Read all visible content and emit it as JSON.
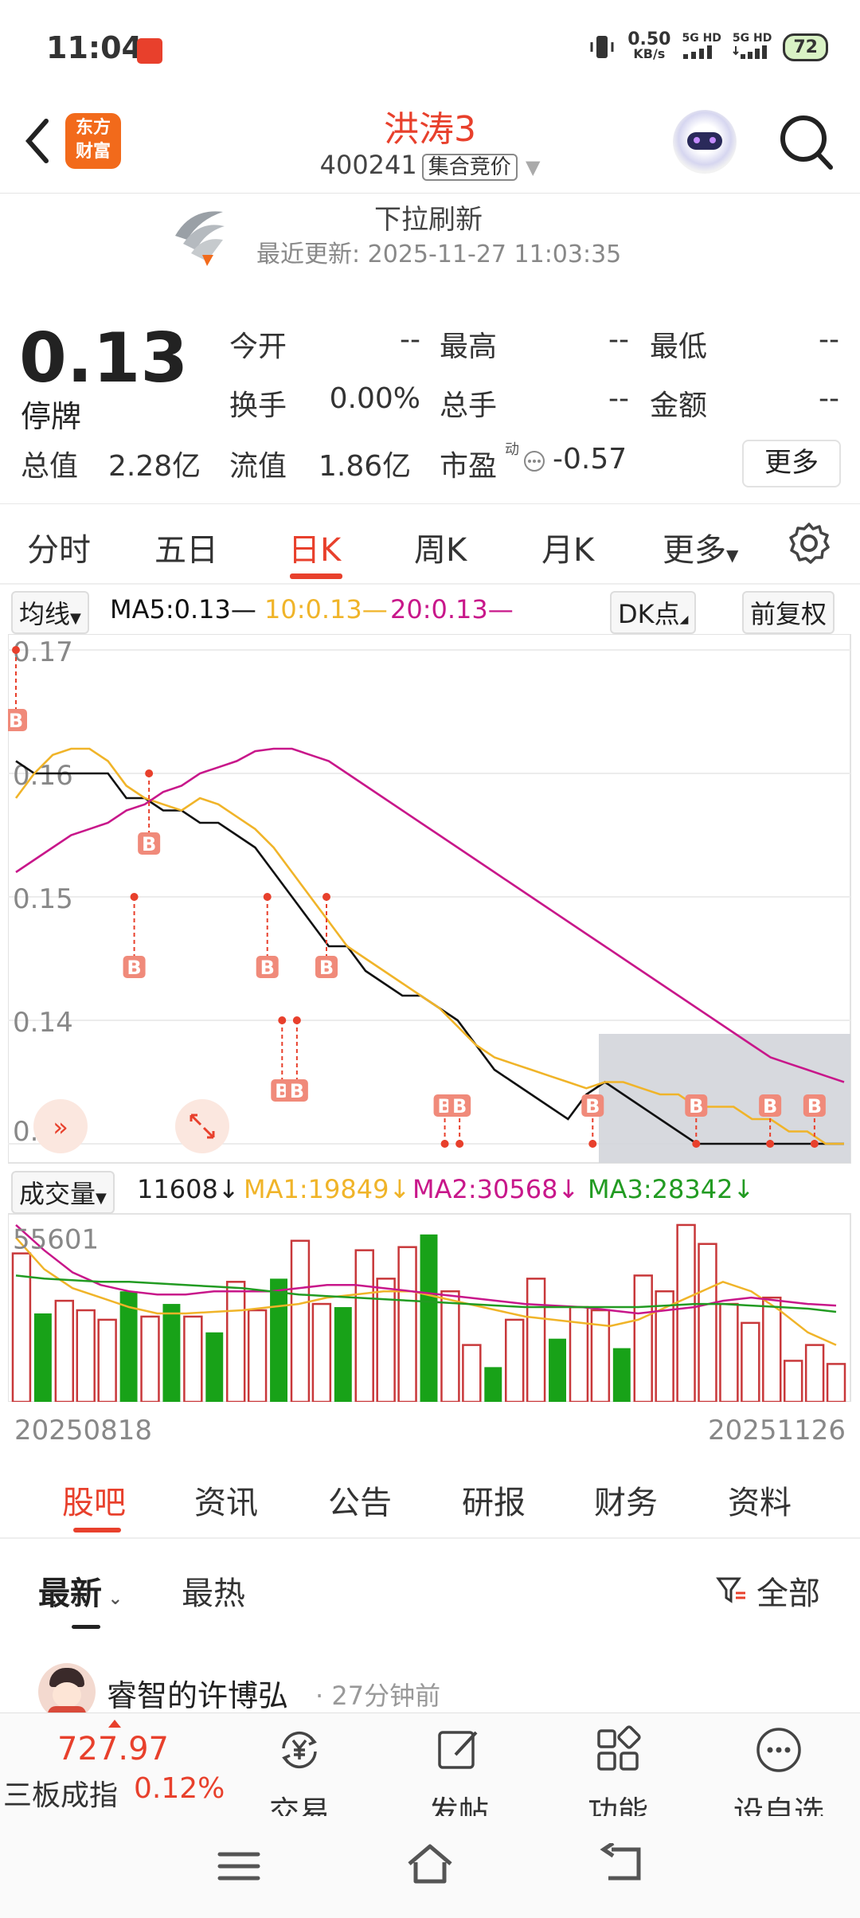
{
  "status_bar": {
    "time": "11:04",
    "speed": "0.50",
    "speed_unit": "KB/s",
    "net1": "5G HD",
    "net2": "5G HD",
    "battery": "72"
  },
  "header": {
    "logo_line1": "东方",
    "logo_line2": "财富",
    "stock_name": "洪涛3",
    "stock_code": "400241",
    "code_tag": "集合竞价"
  },
  "refresh": {
    "title": "下拉刷新",
    "updated": "最近更新: 2025-11-27 11:03:35"
  },
  "quote": {
    "price": "0.13",
    "status": "停牌",
    "rows": [
      [
        {
          "label": "今开",
          "value": "--"
        },
        {
          "label": "最高",
          "value": "--"
        },
        {
          "label": "最低",
          "value": "--"
        }
      ],
      [
        {
          "label": "换手",
          "value": "0.00%"
        },
        {
          "label": "总手",
          "value": "--"
        },
        {
          "label": "金额",
          "value": "--"
        }
      ]
    ],
    "total_mv_label": "总值",
    "total_mv": "2.28亿",
    "float_mv_label": "流值",
    "float_mv": "1.86亿",
    "pe_label": "市盈",
    "pe_sup": "动",
    "pe": "-0.57",
    "more": "更多"
  },
  "tabs": [
    "分时",
    "五日",
    "日K",
    "周K",
    "月K",
    "更多"
  ],
  "ma_bar": {
    "mode": "均线",
    "ma5": "MA5:0.13—",
    "ma10": "10:0.13—",
    "ma20": "20:0.13—",
    "dk": "DK点",
    "adjust": "前复权"
  },
  "vol_bar": {
    "mode": "成交量",
    "vol": "11608↓",
    "ma1": "MA1:19849↓",
    "ma2": "MA2:30568↓",
    "ma3": "MA3:28342↓"
  },
  "colors": {
    "up": "#c8383a",
    "down": "#18a218",
    "ma5": "#111111",
    "ma10": "#f0b429",
    "ma20": "#c8178a",
    "vol_ma3": "#229b22",
    "accent": "#e8402c"
  },
  "chart_data": [
    {
      "type": "line",
      "y_ticks": [
        "0.17",
        "0.16",
        "0.15",
        "0.14",
        "0.13"
      ],
      "ylim": [
        0.13,
        0.17
      ],
      "series": [
        {
          "name": "MA5",
          "values": [
            0.161,
            0.16,
            0.16,
            0.16,
            0.16,
            0.16,
            0.158,
            0.158,
            0.157,
            0.157,
            0.156,
            0.156,
            0.155,
            0.154,
            0.152,
            0.15,
            0.148,
            0.146,
            0.146,
            0.144,
            0.143,
            0.142,
            0.142,
            0.141,
            0.14,
            0.138,
            0.136,
            0.135,
            0.134,
            0.133,
            0.132,
            0.134,
            0.135,
            0.134,
            0.133,
            0.132,
            0.131,
            0.13,
            0.13,
            0.13,
            0.13,
            0.13,
            0.13,
            0.13,
            0.13,
            0.13
          ]
        },
        {
          "name": "MA10",
          "values": [
            0.158,
            0.16,
            0.1615,
            0.162,
            0.162,
            0.161,
            0.159,
            0.158,
            0.1575,
            0.157,
            0.158,
            0.1575,
            0.1565,
            0.1555,
            0.154,
            0.152,
            0.15,
            0.148,
            0.146,
            0.145,
            0.144,
            0.143,
            0.142,
            0.141,
            0.1395,
            0.138,
            0.137,
            0.1365,
            0.136,
            0.1355,
            0.135,
            0.1345,
            0.135,
            0.135,
            0.1345,
            0.134,
            0.134,
            0.133,
            0.133,
            0.133,
            0.132,
            0.132,
            0.131,
            0.131,
            0.13,
            0.13
          ]
        },
        {
          "name": "MA20",
          "values": [
            0.152,
            0.153,
            0.154,
            0.155,
            0.1555,
            0.156,
            0.157,
            0.1575,
            0.1585,
            0.159,
            0.16,
            0.1605,
            0.161,
            0.1618,
            0.162,
            0.162,
            0.1615,
            0.161,
            0.16,
            0.159,
            0.158,
            0.157,
            0.156,
            0.155,
            0.154,
            0.153,
            0.152,
            0.151,
            0.15,
            0.149,
            0.148,
            0.147,
            0.146,
            0.145,
            0.144,
            0.143,
            0.142,
            0.141,
            0.14,
            0.139,
            0.138,
            0.137,
            0.1365,
            0.136,
            0.1355,
            0.135
          ]
        }
      ],
      "markers": [
        {
          "label": "B",
          "index": 0,
          "price": 0.17
        },
        {
          "label": "B",
          "index": 9,
          "price": 0.16
        },
        {
          "label": "B",
          "index": 8,
          "price": 0.15
        },
        {
          "label": "B",
          "index": 17,
          "price": 0.15
        },
        {
          "label": "B",
          "index": 21,
          "price": 0.15
        },
        {
          "label": "B",
          "index": 18,
          "price": 0.14
        },
        {
          "label": "B",
          "index": 19,
          "price": 0.14
        },
        {
          "label": "B",
          "index": 29,
          "price": 0.13
        },
        {
          "label": "B",
          "index": 30,
          "price": 0.13
        },
        {
          "label": "B",
          "index": 39,
          "price": 0.13
        },
        {
          "label": "B",
          "index": 46,
          "price": 0.13
        },
        {
          "label": "B",
          "index": 51,
          "price": 0.13
        },
        {
          "label": "B",
          "index": 54,
          "price": 0.13
        }
      ]
    },
    {
      "type": "bar",
      "y_ticks": [
        "55601"
      ],
      "first_date": "20250818",
      "last_date": "20251126",
      "volumes": [
        {
          "v": 47000,
          "up": true
        },
        {
          "v": 28000,
          "up": false
        },
        {
          "v": 32000,
          "up": true
        },
        {
          "v": 29000,
          "up": true
        },
        {
          "v": 26000,
          "up": true
        },
        {
          "v": 35000,
          "up": false
        },
        {
          "v": 27000,
          "up": true
        },
        {
          "v": 31000,
          "up": false
        },
        {
          "v": 27000,
          "up": true
        },
        {
          "v": 22000,
          "up": false
        },
        {
          "v": 38000,
          "up": true
        },
        {
          "v": 29000,
          "up": true
        },
        {
          "v": 39000,
          "up": false
        },
        {
          "v": 51000,
          "up": true
        },
        {
          "v": 31000,
          "up": true
        },
        {
          "v": 30000,
          "up": false
        },
        {
          "v": 48000,
          "up": true
        },
        {
          "v": 39000,
          "up": true
        },
        {
          "v": 49000,
          "up": true
        },
        {
          "v": 53000,
          "up": false
        },
        {
          "v": 35000,
          "up": true
        },
        {
          "v": 18000,
          "up": true
        },
        {
          "v": 11000,
          "up": false
        },
        {
          "v": 26000,
          "up": true
        },
        {
          "v": 39000,
          "up": true
        },
        {
          "v": 20000,
          "up": false
        },
        {
          "v": 30000,
          "up": true
        },
        {
          "v": 29000,
          "up": true
        },
        {
          "v": 17000,
          "up": false
        },
        {
          "v": 40000,
          "up": true
        },
        {
          "v": 35000,
          "up": true
        },
        {
          "v": 56000,
          "up": true
        },
        {
          "v": 50000,
          "up": true
        },
        {
          "v": 31000,
          "up": true
        },
        {
          "v": 25000,
          "up": true
        },
        {
          "v": 33000,
          "up": true
        },
        {
          "v": 13000,
          "up": true
        },
        {
          "v": 18000,
          "up": true
        },
        {
          "v": 12000,
          "up": true
        }
      ],
      "series": [
        {
          "name": "MA1",
          "values": [
            52000,
            42000,
            36000,
            33000,
            30000,
            28000,
            28000,
            28500,
            29000,
            30000,
            31000,
            33000,
            34000,
            35000,
            35000,
            33000,
            31000,
            29000,
            27000,
            26000,
            25000,
            24000,
            26000,
            30000,
            34000,
            38000,
            35000,
            29000,
            22000,
            18000
          ]
        },
        {
          "name": "MA2",
          "values": [
            56000,
            48000,
            41000,
            37000,
            35000,
            34000,
            34000,
            35000,
            35000,
            35000,
            36000,
            37000,
            37000,
            36000,
            35000,
            34000,
            33000,
            32000,
            31000,
            30500,
            30000,
            29000,
            28000,
            29000,
            30000,
            32000,
            33000,
            32000,
            31000,
            30500
          ]
        },
        {
          "name": "MA3",
          "values": [
            40000,
            39000,
            38500,
            38000,
            38000,
            37500,
            37000,
            36500,
            36000,
            35000,
            34000,
            33500,
            33000,
            32500,
            32000,
            31500,
            31000,
            30500,
            30000,
            30000,
            30000,
            30000,
            30000,
            30500,
            31000,
            31000,
            30500,
            30000,
            29500,
            28500
          ]
        }
      ]
    }
  ],
  "sub_tabs": [
    "股吧",
    "资讯",
    "公告",
    "研报",
    "财务",
    "资料"
  ],
  "feed": {
    "latest": "最新",
    "hot": "最热",
    "filter": "全部"
  },
  "post": {
    "author": "睿智的许博弘",
    "time": "· 27分钟前"
  },
  "bottom_bar": {
    "index_value": "727.97",
    "index_name": "三板成指",
    "index_change": "0.12%",
    "trade": "交易",
    "post": "发帖",
    "function": "功能",
    "watch": "设自选"
  }
}
